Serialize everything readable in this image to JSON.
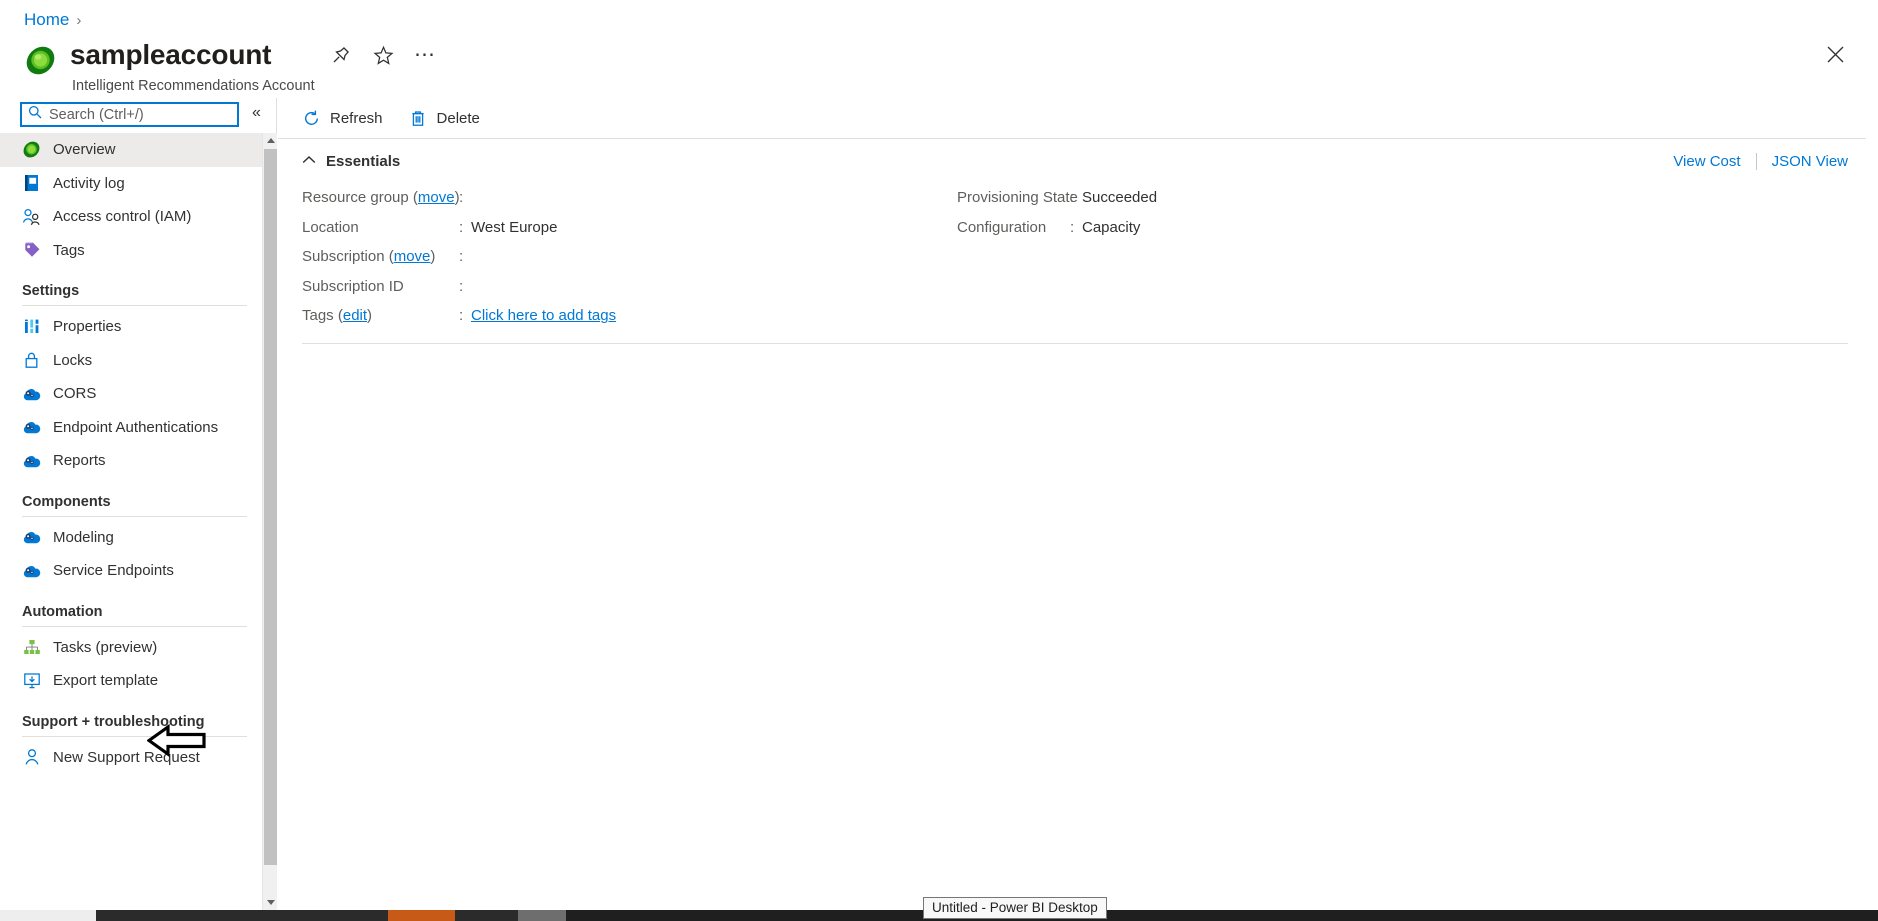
{
  "breadcrumb": {
    "home": "Home",
    "separator": "›"
  },
  "header": {
    "title": "sampleaccount",
    "subtitle": "Intelligent Recommendations Account",
    "pin_label": "Pin",
    "favorite_label": "Favorite",
    "more_label": "More",
    "close_label": "Close"
  },
  "search": {
    "placeholder": "Search (Ctrl+/)",
    "value": "",
    "collapse_label": "«"
  },
  "sidebar": {
    "top_items": [
      {
        "label": "Overview",
        "icon": "resource-globe-icon",
        "selected": true
      },
      {
        "label": "Activity log",
        "icon": "activity-log-icon",
        "selected": false
      },
      {
        "label": "Access control (IAM)",
        "icon": "people-icon",
        "selected": false
      },
      {
        "label": "Tags",
        "icon": "tag-icon",
        "selected": false
      }
    ],
    "groups": [
      {
        "title": "Settings",
        "items": [
          {
            "label": "Properties",
            "icon": "properties-icon"
          },
          {
            "label": "Locks",
            "icon": "lock-icon"
          },
          {
            "label": "CORS",
            "icon": "cloud-gear-icon"
          },
          {
            "label": "Endpoint Authentications",
            "icon": "cloud-gear-icon"
          },
          {
            "label": "Reports",
            "icon": "cloud-gear-icon"
          }
        ]
      },
      {
        "title": "Components",
        "items": [
          {
            "label": "Modeling",
            "icon": "cloud-gear-icon"
          },
          {
            "label": "Service Endpoints",
            "icon": "cloud-gear-icon"
          }
        ]
      },
      {
        "title": "Automation",
        "items": [
          {
            "label": "Tasks (preview)",
            "icon": "tasks-icon"
          },
          {
            "label": "Export template",
            "icon": "export-template-icon"
          }
        ]
      },
      {
        "title": "Support + troubleshooting",
        "items": [
          {
            "label": "New Support Request",
            "icon": "support-person-icon"
          }
        ]
      }
    ]
  },
  "toolbar": {
    "refresh_label": "Refresh",
    "delete_label": "Delete"
  },
  "essentials": {
    "title": "Essentials",
    "collapse_icon": "chevron-up-icon",
    "view_cost_label": "View Cost",
    "json_view_label": "JSON View",
    "left_fields": [
      {
        "key": "Resource group",
        "link": "move",
        "key_suffix": ")",
        "separator": ":",
        "value": ""
      },
      {
        "key": "Location",
        "link": "",
        "key_suffix": "",
        "separator": ":",
        "value": "West Europe"
      },
      {
        "key": "Subscription",
        "link": "move",
        "key_suffix": ")",
        "separator": ":",
        "value": ""
      },
      {
        "key": "Subscription ID",
        "link": "",
        "key_suffix": "",
        "separator": ":",
        "value": ""
      },
      {
        "key": "Tags",
        "link": "edit",
        "key_suffix": ")",
        "separator": ":",
        "value": "Click here to add tags",
        "value_is_link": true
      }
    ],
    "right_fields": [
      {
        "key": "Provisioning State",
        "separator": ":",
        "value": "Succeeded"
      },
      {
        "key": "Configuration",
        "separator": ":",
        "value": "Capacity"
      }
    ]
  },
  "taskbar": {
    "tooltip": "Untitled - Power BI Desktop"
  },
  "colors": {
    "accent": "#0078d4",
    "selected_bg": "#edebe9",
    "border": "#e1dfdd",
    "text": "#323130",
    "muted": "#605e5c",
    "resource_green": "#4caf1f"
  }
}
